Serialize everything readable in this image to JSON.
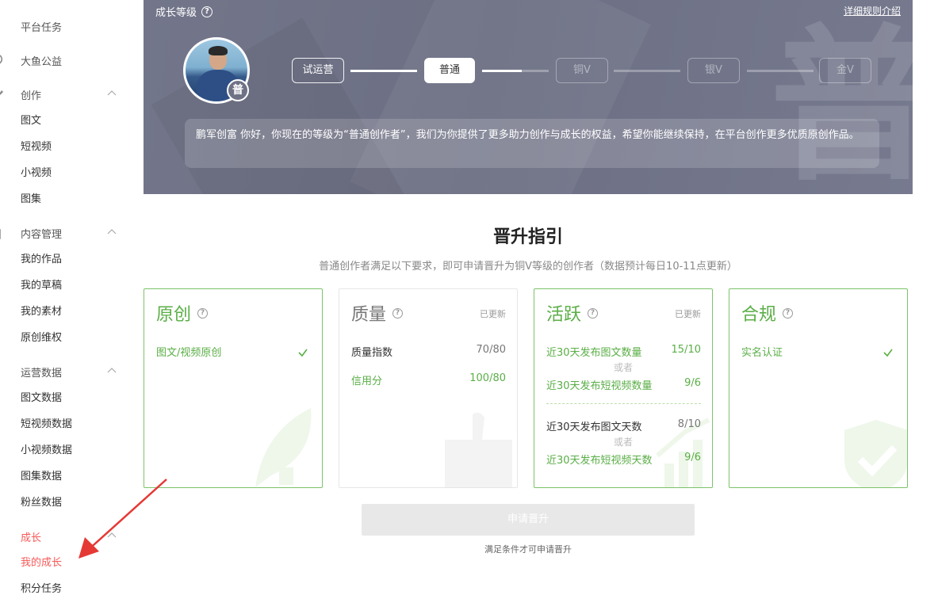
{
  "sidebar": {
    "groups": [
      {
        "label": "平台任务",
        "icon": "flag-icon"
      },
      {
        "label": "大鱼公益",
        "icon": "heart-icon"
      },
      {
        "label": "创作",
        "icon": "pen-icon",
        "items": [
          "图文",
          "短视频",
          "小视频",
          "图集"
        ]
      },
      {
        "label": "内容管理",
        "icon": "folder-icon",
        "items": [
          "我的作品",
          "我的草稿",
          "我的素材",
          "原创维权"
        ]
      },
      {
        "label": "运营数据",
        "icon": "bar-chart-icon",
        "items": [
          "图文数据",
          "短视频数据",
          "小视频数据",
          "图集数据",
          "粉丝数据"
        ]
      },
      {
        "label": "成长",
        "icon": "rocket-icon",
        "items": [
          "我的成长",
          "积分任务"
        ]
      }
    ],
    "active_item": "我的成长",
    "accent_color": "#f85959"
  },
  "banner": {
    "title": "成长等级",
    "help_icon": "help-circle-icon",
    "rules_link": "详细规则介绍",
    "badge_char": "普",
    "watermark_char": "普",
    "levels": [
      {
        "label": "试运营",
        "state": "done"
      },
      {
        "label": "普通",
        "state": "current"
      },
      {
        "label": "铜V",
        "state": "locked"
      },
      {
        "label": "银V",
        "state": "locked"
      },
      {
        "label": "金V",
        "state": "locked"
      }
    ],
    "progress_to_next": 0.6,
    "message": "鹏军创富 你好，你现在的等级为“普通创作者”，我们为你提供了更多助力创作与成长的权益，希望你能继续保持，在平台创作更多优质原创作品。"
  },
  "guide": {
    "title": "晋升指引",
    "subtitle": "普通创作者满足以下要求，即可申请晋升为铜V等级的创作者（数据预计每日10-11点更新）",
    "cards": {
      "original": {
        "title": "原创",
        "req": "图文/视频原创"
      },
      "quality": {
        "title": "质量",
        "updated": "已更新",
        "r1_label": "质量指数",
        "r1_value": "70/80",
        "r2_label": "信用分",
        "r2_value": "100/80"
      },
      "active": {
        "title": "活跃",
        "updated": "已更新",
        "r1_label": "近30天发布图文数量",
        "r1_value": "15/10",
        "or1": "或者",
        "r2_label": "近30天发布短视频数量",
        "r2_value": "9/6",
        "r3_label": "近30天发布图文天数",
        "r3_value": "8/10",
        "or2": "或者",
        "r4_label": "近30天发布短视频天数",
        "r4_value": "9/6"
      },
      "compliance": {
        "title": "合规",
        "req": "实名认证"
      }
    },
    "apply_button": "申请晋升",
    "apply_hint": "满足条件才可申请晋升"
  },
  "colors": {
    "green": "#5aae46",
    "banner": "#6f7285",
    "red": "#f85959"
  }
}
